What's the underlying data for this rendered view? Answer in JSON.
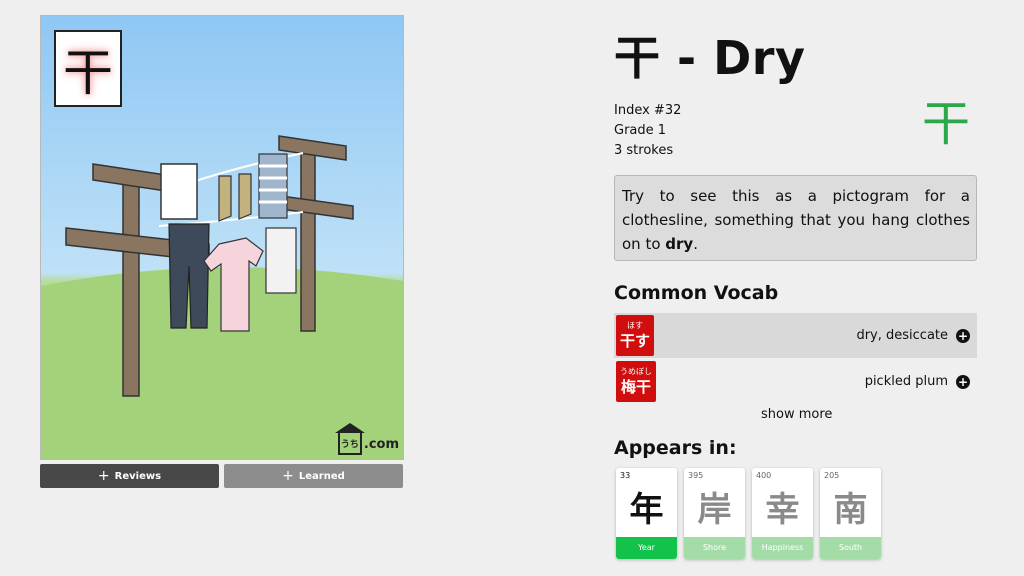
{
  "illustration": {
    "stamp_kanji": "干",
    "site_mark_house": "うち",
    "site_mark_suffix": ".com"
  },
  "buttons": {
    "reviews_label": "Reviews",
    "learned_label": "Learned",
    "plus_glyph": "+"
  },
  "kanji": {
    "title": "干 - Dry",
    "index": "Index #32",
    "grade": "Grade 1",
    "strokes": "3 strokes",
    "stroke_glyph": "干",
    "stroke_color": "#2aa84a"
  },
  "mnemonic": {
    "text_before": "Try to see this as a pictogram for a clothesline, something that you hang clothes on to ",
    "bold_word": "dry",
    "text_after": "."
  },
  "vocab": {
    "heading": "Common Vocab",
    "items": [
      {
        "furigana": "ほす",
        "word": "干す",
        "meaning": "dry, desiccate"
      },
      {
        "furigana": "うめぼし",
        "word": "梅干",
        "meaning": "pickled plum"
      }
    ],
    "show_more": "show more",
    "badge_color": "#d10e0e"
  },
  "appears_in": {
    "heading": "Appears in:",
    "cards": [
      {
        "number": "33",
        "kanji": "年",
        "label": "Year",
        "active": true
      },
      {
        "number": "395",
        "kanji": "岸",
        "label": "Shore",
        "active": false
      },
      {
        "number": "400",
        "kanji": "幸",
        "label": "Happiness",
        "active": false
      },
      {
        "number": "205",
        "kanji": "南",
        "label": "South",
        "active": false
      }
    ],
    "active_color": "#12c24a",
    "inactive_color": "#a4dca8"
  }
}
